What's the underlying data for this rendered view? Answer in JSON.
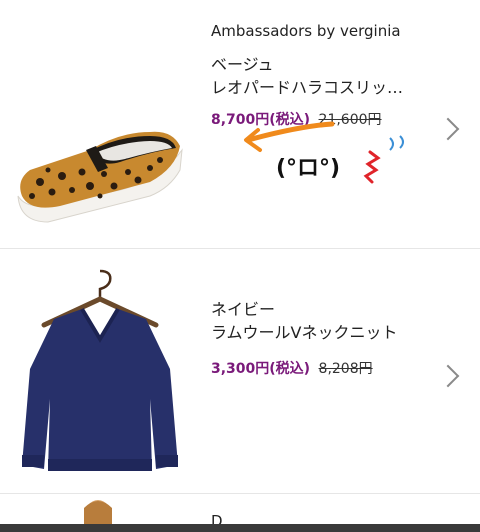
{
  "items": [
    {
      "brand": "Ambassadors by verginia",
      "title_line1": "ベージュ",
      "title_line2": "レオパードハラコスリッ…",
      "price": "8,700円(税込)",
      "original_price": "21,600円",
      "doodle_face": "(°ロ°)"
    },
    {
      "title_line1": "ネイビー",
      "title_line2": "ラムウールVネックニット",
      "price": "3,300円(税込)",
      "original_price": "8,208円"
    },
    {
      "brand": "D"
    }
  ],
  "colors": {
    "price": "#7a1a7a",
    "doodle_arrow": "#f08a1c",
    "doodle_mark": "#e0242a",
    "doodle_drops": "#3b8fd6",
    "leopard_base": "#c8892f",
    "sweater": "#27306a"
  },
  "icons": [
    "chevron-right-icon",
    "chevron-right-icon"
  ]
}
